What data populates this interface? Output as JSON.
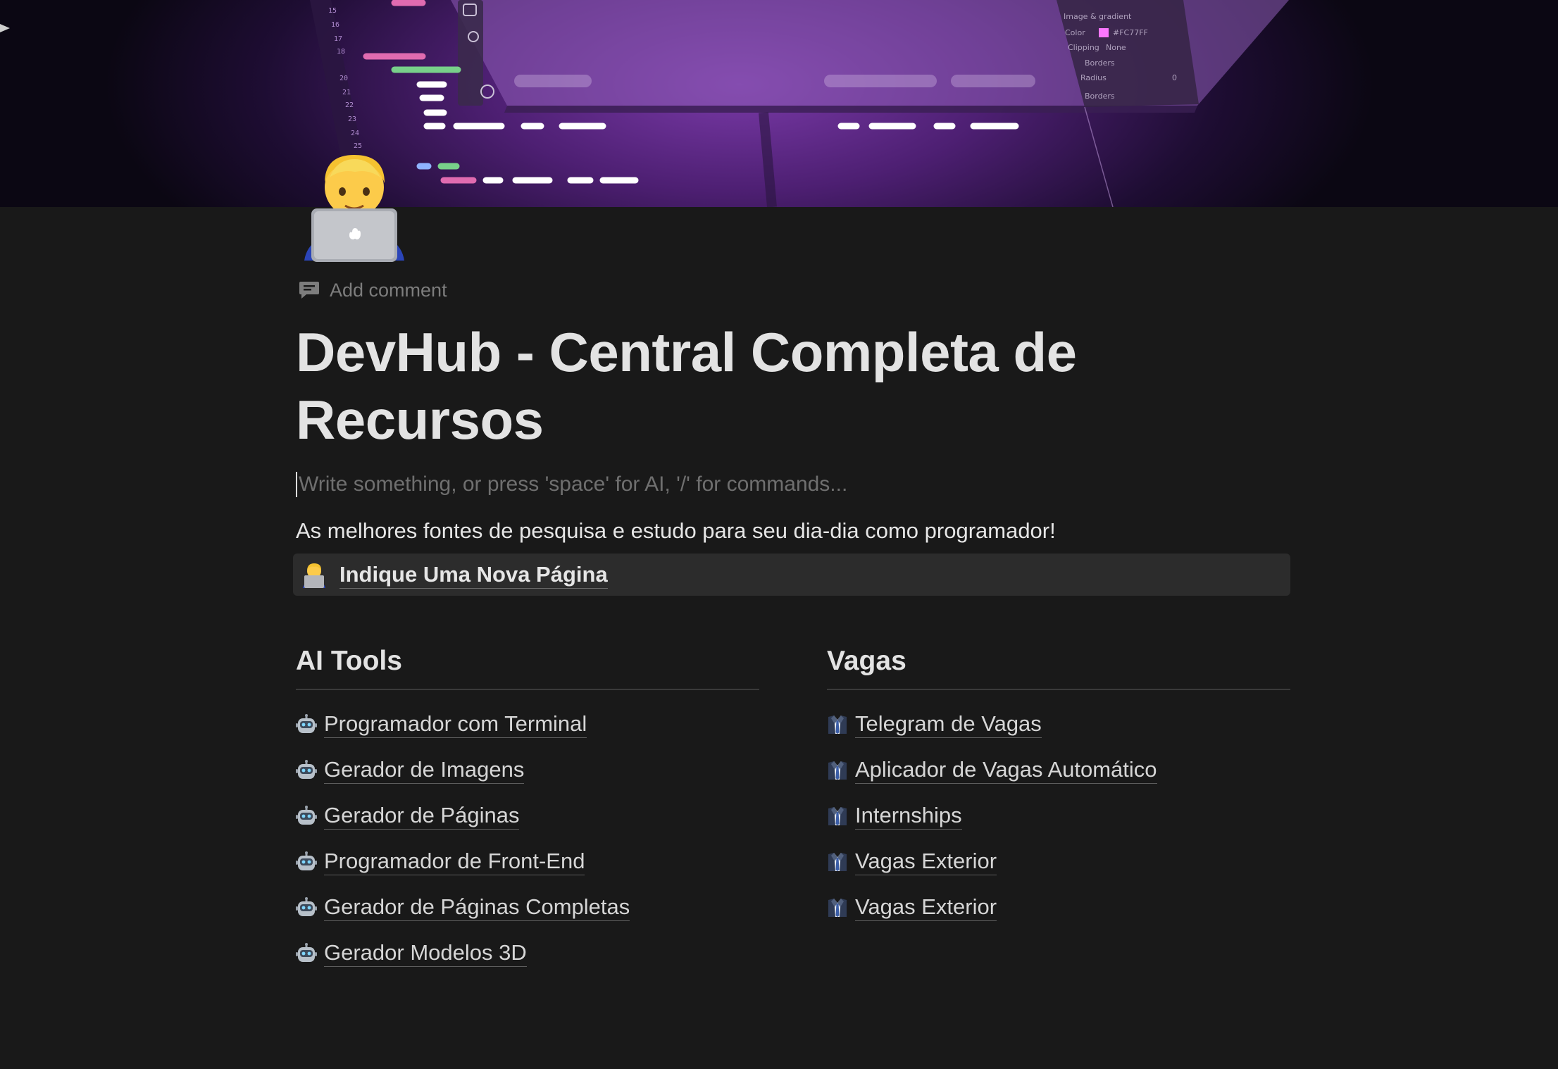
{
  "cover": {
    "editor_fragments": [
      "Image & gradient",
      "Color",
      "#FC77FF",
      "Clipping",
      "None",
      "Borders",
      "Radius",
      "0",
      "Borders"
    ]
  },
  "page": {
    "icon": "person-with-laptop-emoji",
    "add_comment_label": "Add comment",
    "title": "DevHub - Central Completa de Recursos",
    "editor_placeholder": "Write something, or press 'space' for AI, '/' for commands...",
    "intro": "As melhores fontes de pesquisa e estudo para seu dia-dia como programador!"
  },
  "callout": {
    "icon": "person-with-laptop-emoji",
    "link_label": "Indique Uma Nova Página"
  },
  "columns": {
    "left": {
      "heading": "AI Tools",
      "icon": "robot-icon",
      "items": [
        "Programador com Terminal",
        "Gerador de Imagens",
        "Gerador de Páginas",
        "Programador de Front-End",
        "Gerador de Páginas Completas",
        "Gerador Modelos 3D"
      ]
    },
    "right": {
      "heading": "Vagas",
      "icon": "suit-icon",
      "items": [
        "Telegram de Vagas",
        "Aplicador de Vagas Automático",
        "Internships",
        "Vagas Exterior",
        "Vagas Exterior"
      ]
    }
  }
}
